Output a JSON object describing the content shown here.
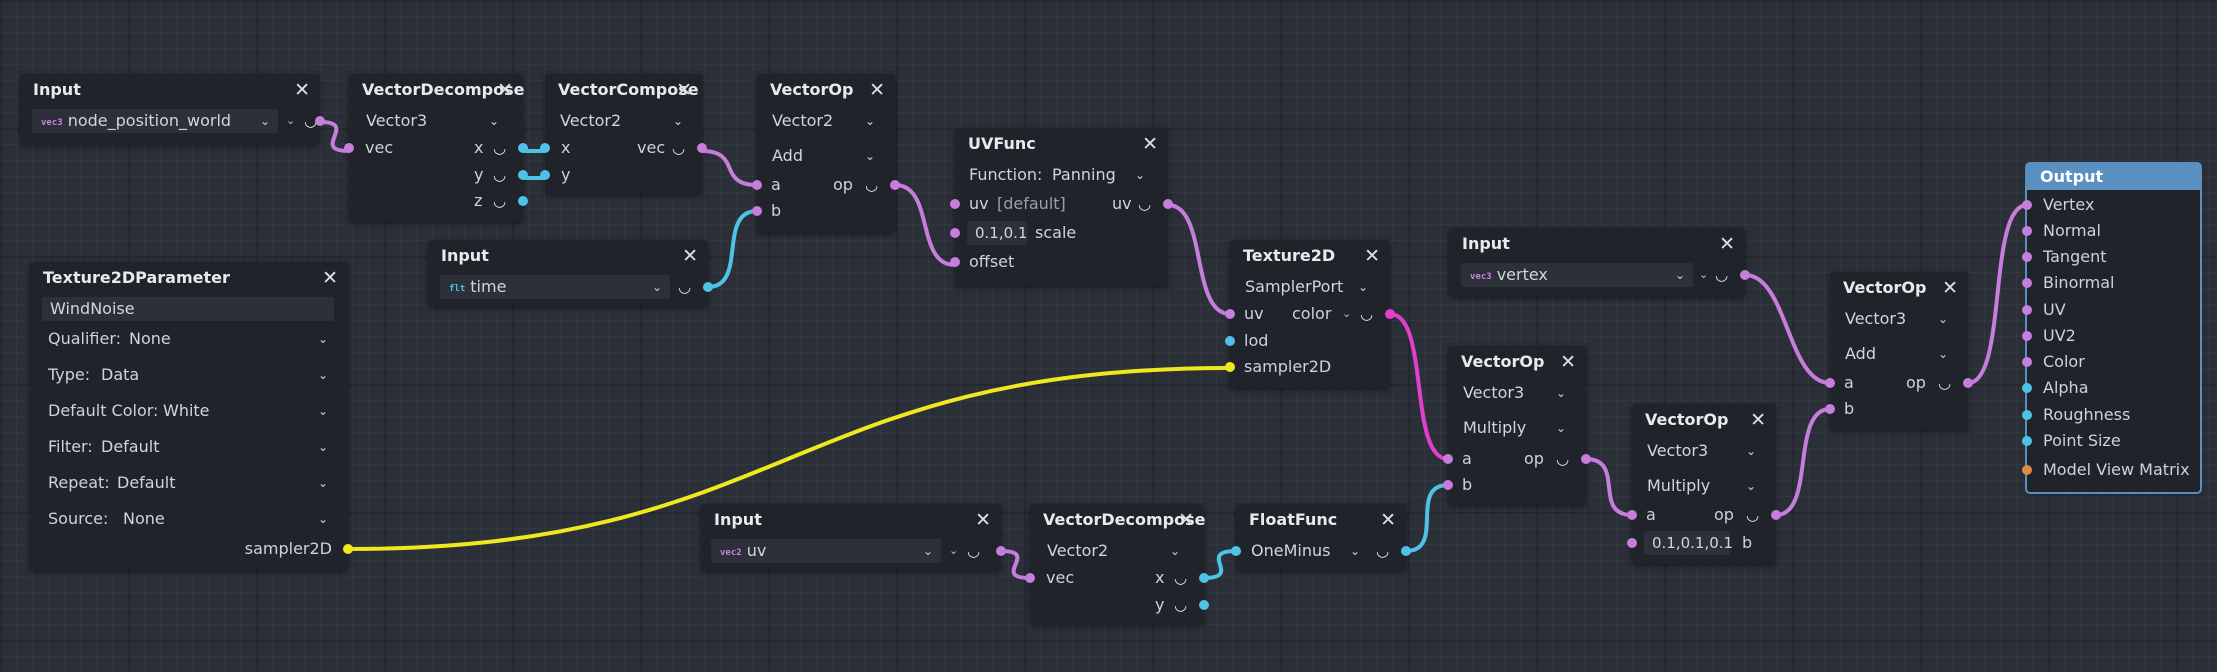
{
  "nodes": {
    "input_pos": {
      "title": "Input",
      "value": "node_position_world",
      "badge": "vec3"
    },
    "vdecomp1": {
      "title": "VectorDecompose",
      "type": "Vector3",
      "in": "vec",
      "out_x": "x",
      "out_y": "y",
      "out_z": "z"
    },
    "vcomp": {
      "title": "VectorCompose",
      "type": "Vector2",
      "in_x": "x",
      "in_y": "y",
      "out": "vec"
    },
    "vop1": {
      "title": "VectorOp",
      "type": "Vector2",
      "op": "Add",
      "in_a": "a",
      "in_b": "b",
      "out": "op"
    },
    "input_time": {
      "title": "Input",
      "value": "time",
      "badge": "flt"
    },
    "tex_param": {
      "title": "Texture2DParameter",
      "name": "WindNoise",
      "fields": [
        {
          "label": "Qualifier:",
          "value": "None"
        },
        {
          "label": "Type:",
          "value": "Data"
        },
        {
          "label": "Default Color:",
          "value": "White"
        },
        {
          "label": "Filter:",
          "value": "Default"
        },
        {
          "label": "Repeat:",
          "value": "Default"
        },
        {
          "label": "Source:",
          "value": "None"
        }
      ],
      "out": "sampler2D"
    },
    "uvfunc": {
      "title": "UVFunc",
      "function_label": "Function:",
      "function_value": "Panning",
      "in_uv": "uv",
      "uv_default": "[default]",
      "out_uv": "uv",
      "scale_value": "0.1,0.1",
      "in_scale": "scale",
      "in_offset": "offset"
    },
    "texture2d": {
      "title": "Texture2D",
      "source": "SamplerPort",
      "in_uv": "uv",
      "out_color": "color",
      "in_lod": "lod",
      "in_sampler": "sampler2D"
    },
    "input_vertex": {
      "title": "Input",
      "value": "vertex",
      "badge": "vec3"
    },
    "vop2": {
      "title": "VectorOp",
      "type": "Vector3",
      "op": "Multiply",
      "in_a": "a",
      "in_b": "b",
      "out": "op"
    },
    "vop3": {
      "title": "VectorOp",
      "type": "Vector3",
      "op": "Multiply",
      "in_a": "a",
      "b_value": "0.1,0.1,0.1",
      "in_b": "b",
      "out": "op"
    },
    "vop4": {
      "title": "VectorOp",
      "type": "Vector3",
      "op": "Add",
      "in_a": "a",
      "in_b": "b",
      "out": "op"
    },
    "input_uv": {
      "title": "Input",
      "value": "uv",
      "badge": "vec2"
    },
    "vdecomp2": {
      "title": "VectorDecompose",
      "type": "Vector2",
      "in": "vec",
      "out_x": "x",
      "out_y": "y"
    },
    "floatfunc": {
      "title": "FloatFunc",
      "func": "OneMinus"
    },
    "output": {
      "title": "Output",
      "ports": [
        "Vertex",
        "Normal",
        "Tangent",
        "Binormal",
        "UV",
        "UV2",
        "Color",
        "Alpha",
        "Roughness",
        "Point Size",
        "Model View Matrix"
      ]
    }
  },
  "colors": {
    "vec": "#c77ddc",
    "float": "#4ec3e6",
    "sampler": "#f0e71f",
    "color": "#e23fcf",
    "matrix": "#e08a4a",
    "selected": "#5b8fbf"
  },
  "icons": {
    "close": "close-icon",
    "chevron": "chevron-down-icon",
    "preview": "preview-cup-icon"
  }
}
